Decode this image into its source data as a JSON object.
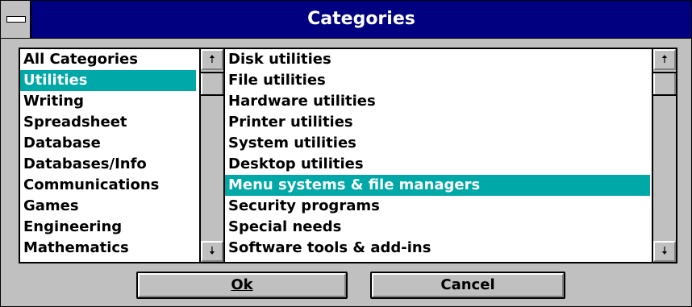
{
  "window": {
    "title": "Categories"
  },
  "categories": {
    "items": [
      "All Categories",
      "Utilities",
      "Writing",
      "Spreadsheet",
      "Database",
      "Databases/Info",
      "Communications",
      "Games",
      "Engineering",
      "Mathematics"
    ],
    "selected_index": 1
  },
  "subcategories": {
    "items": [
      "Disk utilities",
      "File utilities",
      "Hardware utilities",
      "Printer utilities",
      "System utilities",
      "Desktop utilities",
      "Menu systems & file managers",
      "Security programs",
      "Special needs",
      "Software tools & add-ins"
    ],
    "selected_index": 6
  },
  "scrollbar": {
    "up_arrow": "🠅",
    "down_arrow": "🠇"
  },
  "buttons": {
    "ok_label": "Ok",
    "cancel_label": "Cancel"
  },
  "colors": {
    "titlebar": "#000080",
    "selection": "#00a8a8",
    "face": "#c0c0c0"
  }
}
